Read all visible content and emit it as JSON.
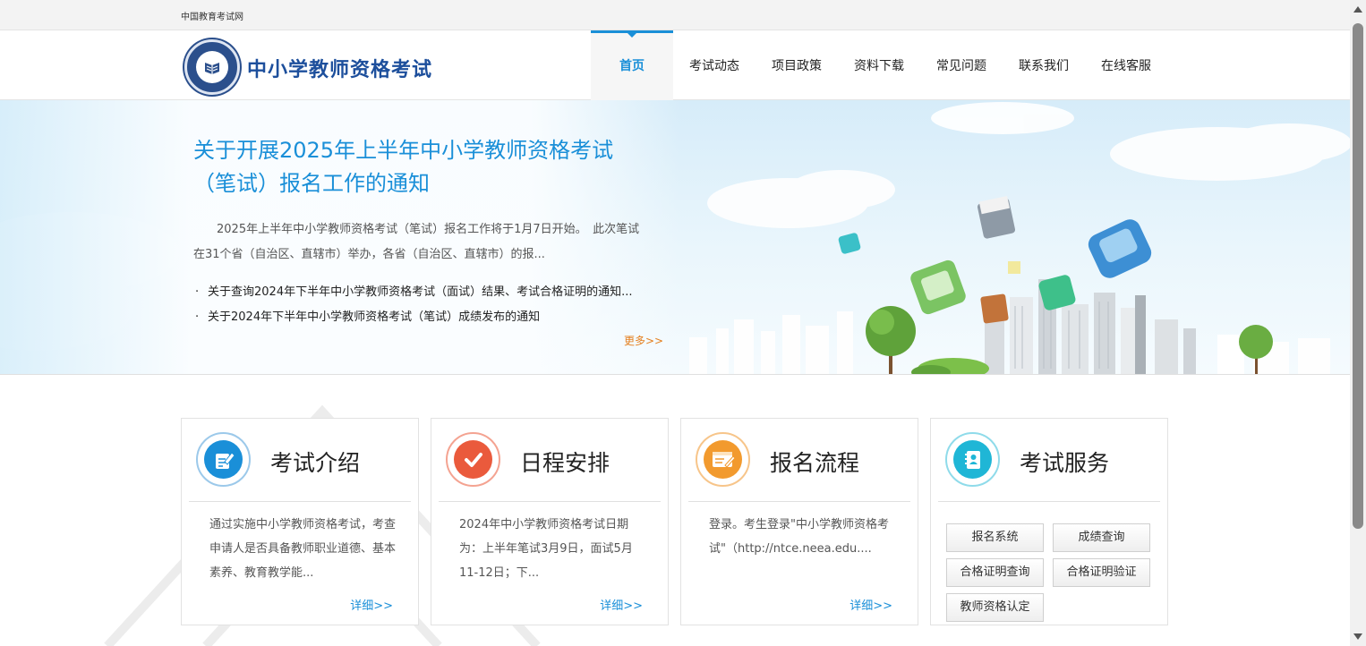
{
  "topbar": {
    "site_link": "中国教育考试网"
  },
  "header": {
    "title": "中小学教师资格考试",
    "nav": [
      {
        "label": "首页",
        "active": true
      },
      {
        "label": "考试动态"
      },
      {
        "label": "项目政策"
      },
      {
        "label": "资料下载"
      },
      {
        "label": "常见问题"
      },
      {
        "label": "联系我们"
      },
      {
        "label": "在线客服"
      }
    ]
  },
  "banner": {
    "headline": "关于开展2025年上半年中小学教师资格考试（笔试）报名工作的通知",
    "summary": "2025年上半年中小学教师资格考试（笔试）报名工作将于1月7日开始。　此次笔试在31个省（自治区、直辖市）举办，各省（自治区、直辖市）的报...",
    "news": [
      "关于查询2024年下半年中小学教师资格考试（面试）结果、考试合格证明的通知...",
      "关于2024年下半年中小学教师资格考试（笔试）成绩发布的通知"
    ],
    "bullet": "·",
    "more": "更多>>"
  },
  "cards": {
    "intro": {
      "icon": "document-edit-icon",
      "title": "考试介绍",
      "desc": "通过实施中小学教师资格考试，考查申请人是否具备教师职业道德、基本素养、教育教学能...",
      "more": "详细>>"
    },
    "schedule": {
      "icon": "checkmark-icon",
      "title": "日程安排",
      "desc": "2024年中小学教师资格考试日期为：上半年笔试3月9日，面试5月11-12日；下...",
      "more": "详细>>"
    },
    "process": {
      "icon": "registration-form-icon",
      "title": "报名流程",
      "desc": "登录。考生登录\"中小学教师资格考试\"（http://ntce.neea.edu....",
      "more": "详细>>"
    },
    "service": {
      "icon": "contact-book-icon",
      "title": "考试服务",
      "buttons": [
        "报名系统",
        "成绩查询",
        "合格证明查询",
        "合格证明验证",
        "教师资格认定"
      ]
    }
  },
  "colors": {
    "accent": "#1a8fd8",
    "brand": "#1d4f9c",
    "more_link": "#e47f1f",
    "schedule_icon": "#ea5a3c",
    "process_icon": "#f29a2e",
    "service_icon": "#1fb6d6"
  }
}
